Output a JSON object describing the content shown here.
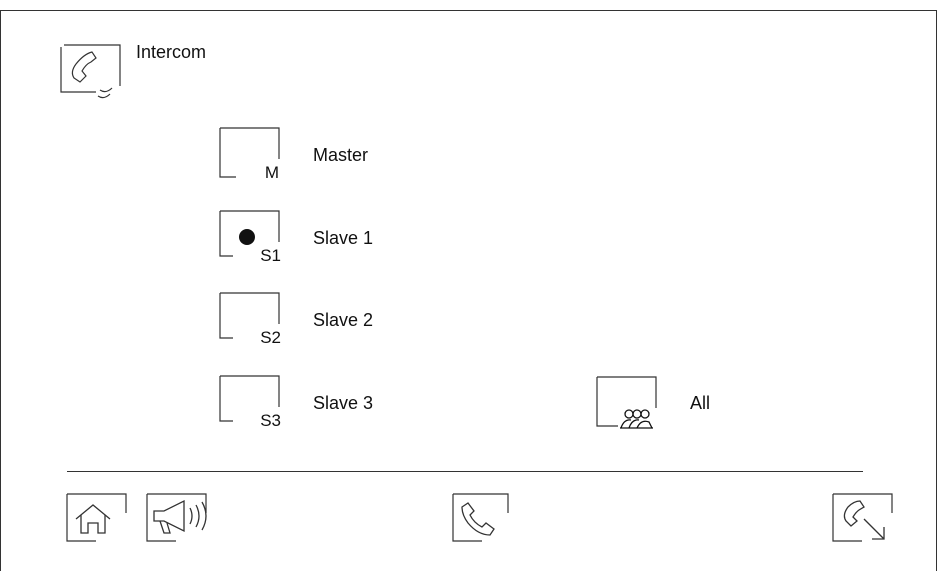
{
  "header": {
    "title": "Intercom"
  },
  "options": [
    {
      "code": "M",
      "label": "Master",
      "selected": false
    },
    {
      "code": "S1",
      "label": "Slave 1",
      "selected": true
    },
    {
      "code": "S2",
      "label": "Slave 2",
      "selected": false
    },
    {
      "code": "S3",
      "label": "Slave 3",
      "selected": false
    }
  ],
  "all": {
    "label": "All"
  },
  "toolbar": {
    "icons": [
      "home-icon",
      "megaphone-icon",
      "call-icon",
      "call-transfer-icon"
    ]
  },
  "colors": {
    "line": "#333333",
    "text": "#111111",
    "background": "#ffffff"
  }
}
